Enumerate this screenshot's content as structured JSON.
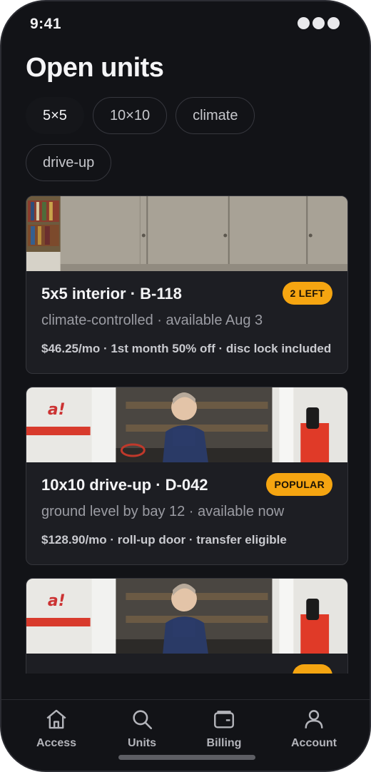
{
  "status_bar": {
    "time": "9:41"
  },
  "page": {
    "title": "Open units"
  },
  "filters": [
    {
      "label": "5×5",
      "selected": true
    },
    {
      "label": "10×10",
      "selected": false
    },
    {
      "label": "climate",
      "selected": false
    },
    {
      "label": "drive-up",
      "selected": false
    }
  ],
  "units": [
    {
      "title": "5x5 interior · B-118",
      "badge": "2 LEFT",
      "subtitle": "climate-controlled · available Aug 3",
      "meta": "$46.25/mo · 1st month 50% off · disc lock included"
    },
    {
      "title": "10x10 drive-up · D-042",
      "badge": "POPULAR",
      "subtitle": "ground level by bay 12 · available now",
      "meta": "$128.90/mo · roll-up door · transfer eligible"
    }
  ],
  "tabs": [
    {
      "label": "Access",
      "icon": "home-icon"
    },
    {
      "label": "Units",
      "icon": "search-icon"
    },
    {
      "label": "Billing",
      "icon": "wallet-icon"
    },
    {
      "label": "Account",
      "icon": "person-icon"
    }
  ],
  "colors": {
    "background": "#121317",
    "card": "#1d1e23",
    "badge": "#f5a511"
  }
}
